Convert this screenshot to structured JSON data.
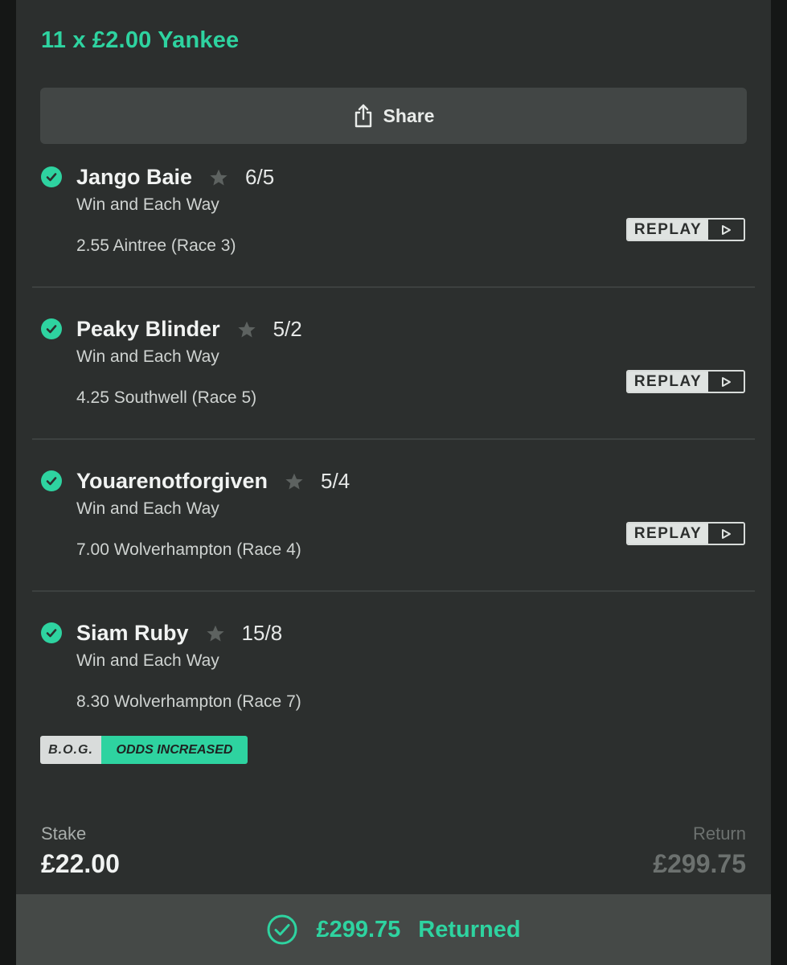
{
  "bet": {
    "title": "11 x £2.00 Yankee",
    "share_label": "Share"
  },
  "legs": [
    {
      "horse": "Jango Baie",
      "odds": "6/5",
      "bet_type": "Win and Each Way",
      "race": "2.55 Aintree (Race 3)",
      "has_replay": true
    },
    {
      "horse": "Peaky Blinder",
      "odds": "5/2",
      "bet_type": "Win and Each Way",
      "race": "4.25 Southwell (Race 5)",
      "has_replay": true
    },
    {
      "horse": "Youarenotforgiven",
      "odds": "5/4",
      "bet_type": "Win and Each Way",
      "race": "7.00 Wolverhampton (Race 4)",
      "has_replay": true
    },
    {
      "horse": "Siam Ruby",
      "odds": "15/8",
      "bet_type": "Win and Each Way",
      "race": "8.30 Wolverhampton (Race 7)",
      "has_replay": false
    }
  ],
  "replay_label": "REPLAY",
  "bog": {
    "left": "B.O.G.",
    "right": "ODDS INCREASED"
  },
  "stake": {
    "label": "Stake",
    "value": "£22.00"
  },
  "return": {
    "label": "Return",
    "value": "£299.75"
  },
  "footer": {
    "amount": "£299.75",
    "text": "Returned"
  },
  "colors": {
    "accent": "#2ed3a0",
    "card_bg": "#2c2f2e",
    "footer_bg": "#454947",
    "muted_star": "#5d6260"
  },
  "icons": {
    "share": "share-icon",
    "check": "check-circle-icon",
    "star": "star-icon",
    "play": "play-icon"
  }
}
